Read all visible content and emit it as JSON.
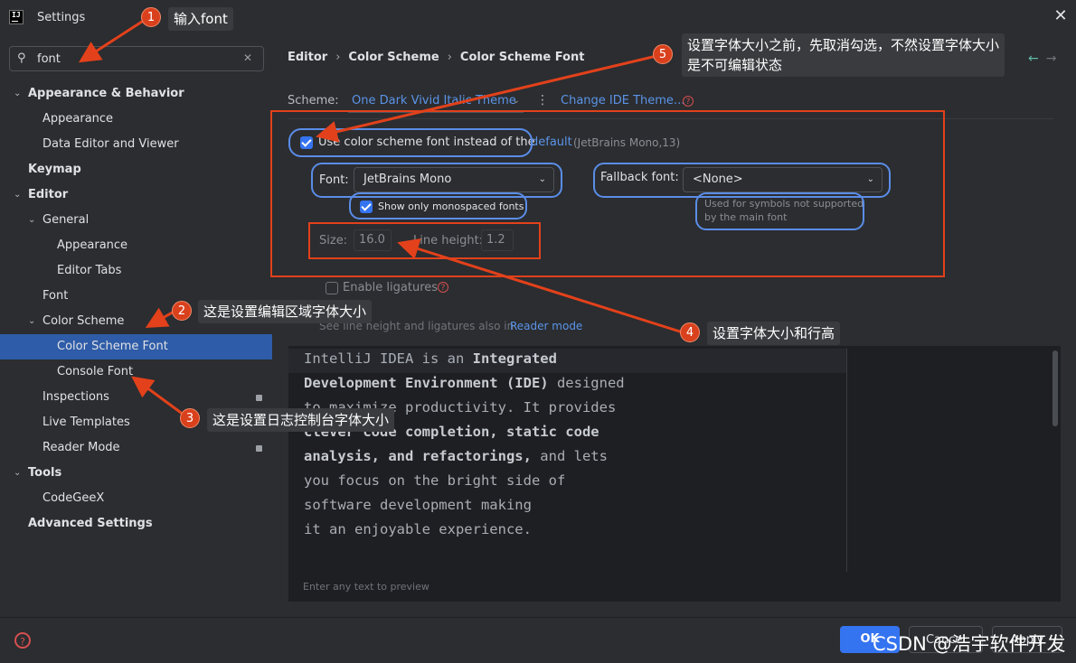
{
  "window": {
    "title": "Settings"
  },
  "search": {
    "value": "font",
    "icon": "search-icon"
  },
  "sidebar": {
    "items": [
      {
        "label": "Appearance & Behavior",
        "chevron": "⌄"
      },
      {
        "label": "Appearance"
      },
      {
        "label": "Data Editor and Viewer"
      },
      {
        "label": "Keymap"
      },
      {
        "label": "Editor",
        "chevron": "⌄"
      },
      {
        "label": "General",
        "chevron": "⌄"
      },
      {
        "label": "Appearance"
      },
      {
        "label": "Editor Tabs"
      },
      {
        "label": "Font"
      },
      {
        "label": "Color Scheme",
        "chevron": "⌄"
      },
      {
        "label": "Color Scheme Font"
      },
      {
        "label": "Console Font"
      },
      {
        "label": "Inspections"
      },
      {
        "label": "Live Templates"
      },
      {
        "label": "Reader Mode"
      },
      {
        "label": "Tools",
        "chevron": "⌄"
      },
      {
        "label": "CodeGeeX"
      },
      {
        "label": "Advanced Settings"
      }
    ]
  },
  "breadcrumb": {
    "part1": "Editor",
    "part2": "Color Scheme",
    "part3": "Color Scheme Font",
    "sep": "›"
  },
  "nav": {
    "back": "←",
    "forward": "→"
  },
  "scheme": {
    "label": "Scheme:",
    "value": "One Dark Vivid Italic Theme",
    "change_theme": "Change IDE Theme..."
  },
  "font_settings": {
    "use_scheme_font_label": "Use color scheme font instead of the",
    "default_link": "default",
    "default_detail": "(JetBrains Mono,13)",
    "font_label": "Font:",
    "font_value": "JetBrains Mono",
    "show_monospaced_label": "Show only monospaced fonts",
    "fallback_label": "Fallback font:",
    "fallback_value": "<None>",
    "fallback_hint_1": "Used for symbols not supported",
    "fallback_hint_2": "by the main font",
    "size_label": "Size:",
    "size_value": "16.0",
    "line_height_label": "Line height:",
    "line_height_value": "1.2",
    "ligatures_label": "Enable ligatures",
    "reader_hint": "See line height and ligatures also in",
    "reader_link": "Reader mode"
  },
  "preview": {
    "hint": "Enter any text to preview"
  },
  "footer": {
    "ok": "OK",
    "cancel": "Cancel",
    "apply": "Apply"
  },
  "annotations": {
    "m1": "1",
    "c1": "输入font",
    "m2": "2",
    "c2": "这是设置编辑区域字体大小",
    "m3": "3",
    "c3": "这是设置日志控制台字体大小",
    "m4": "4",
    "c4": "设置字体大小和行高",
    "m5": "5",
    "c5_line1": "设置字体大小之前，先取消勾选，不然设置字体大小",
    "c5_line2": "是不可编辑状态"
  },
  "watermark": "CSDN @浩宇软件开发",
  "colors": {
    "accent": "#3574f0",
    "selection": "#2e5ca8",
    "annotation_red": "#e2411b",
    "annotation_blue": "#5b8de8"
  }
}
